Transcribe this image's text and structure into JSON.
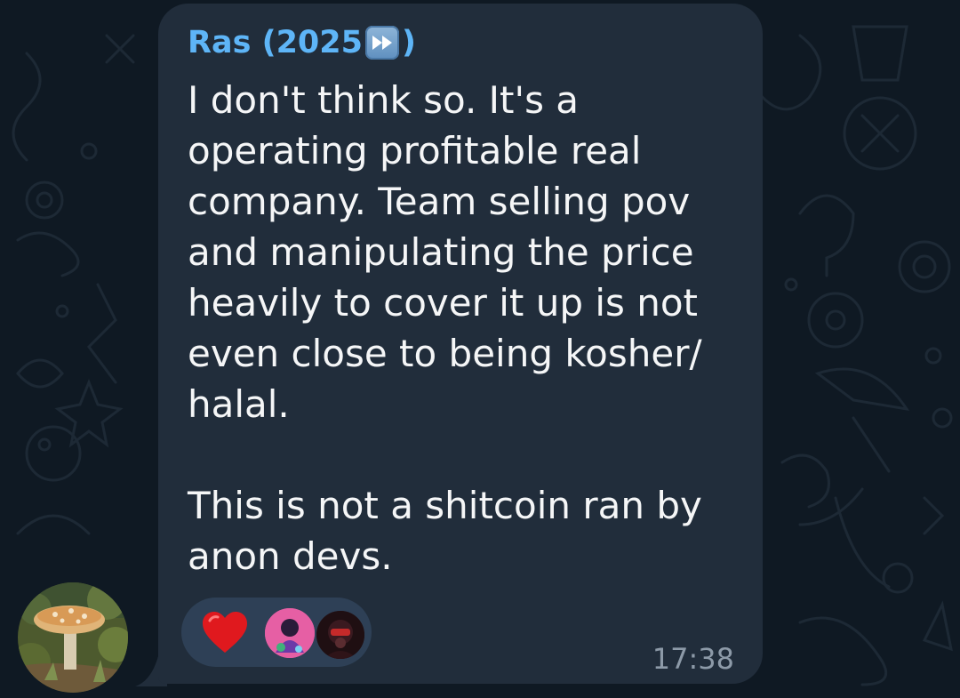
{
  "message": {
    "sender_name": "Ras (2025",
    "sender_emoji": "fast-forward-emoji",
    "sender_suffix": ")",
    "text": "I don't think so. It's a operating profitable real company. Team selling pov and manipulating the price heavily to cover it up is not even close to being kosher/ halal.\n\nThis is not a shitcoin ran by anon devs.",
    "time": "17:38"
  },
  "reactions": {
    "emoji": "red-heart",
    "reactor_count_shown": 2
  },
  "colors": {
    "background": "#0f1923",
    "bubble": "#212d3b",
    "sender": "#5eb5f7",
    "text": "#f5f6f7",
    "reaction_pill": "#2e4056",
    "timestamp": "#8d9aa8"
  }
}
